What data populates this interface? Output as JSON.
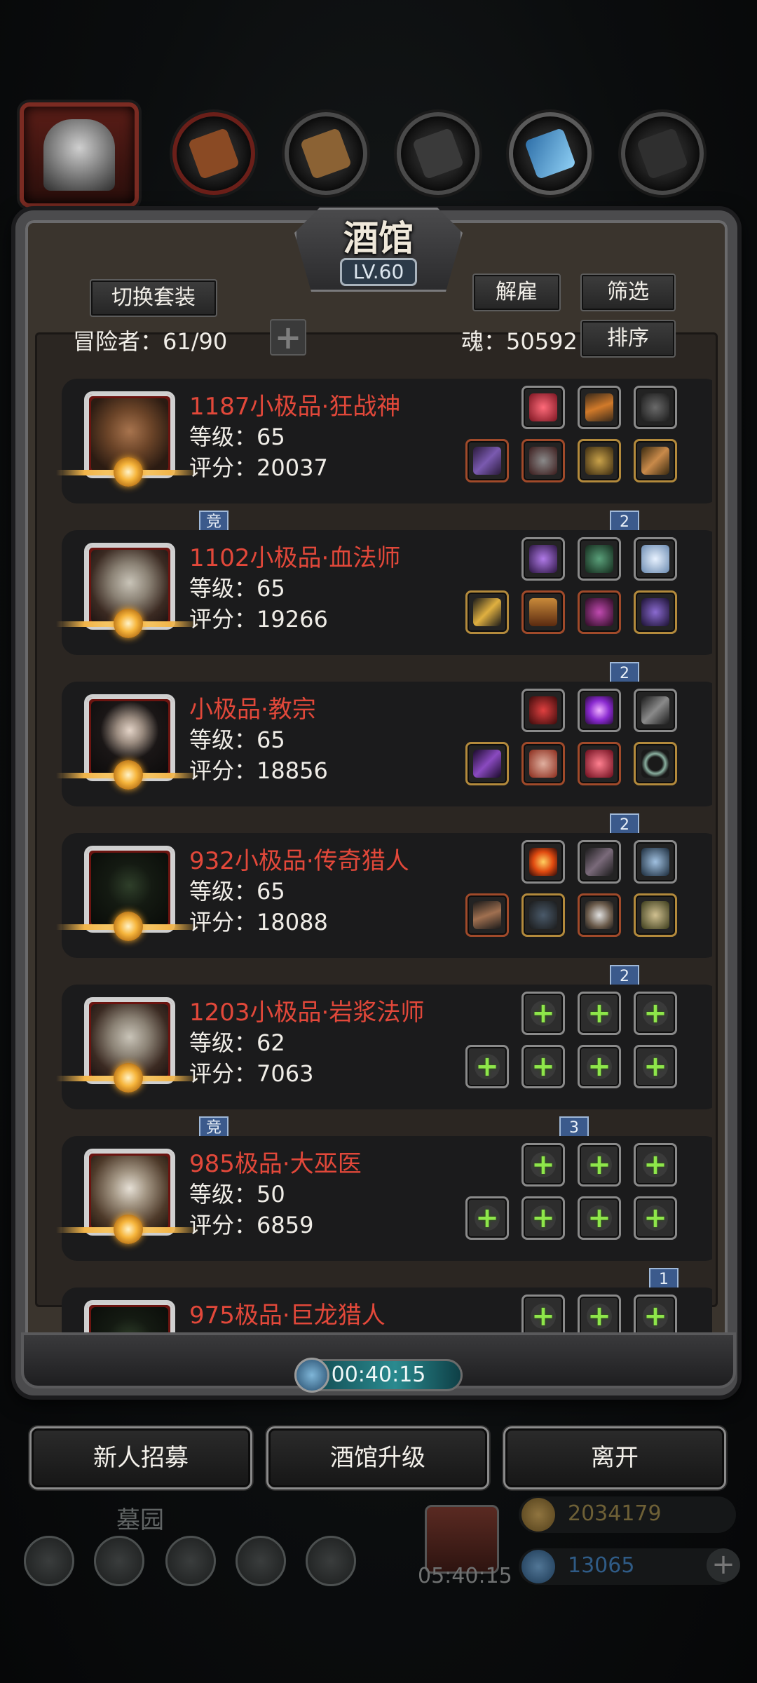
{
  "tavern": {
    "title": "酒馆",
    "level": "LV.60"
  },
  "toolbar": {
    "switch_set_label": "切换套装",
    "dismiss_label": "解雇",
    "filter_label": "筛选",
    "sort_label": "排序"
  },
  "stats": {
    "adventurers_label": "冒险者：61/90",
    "soul_label": "魂：50592",
    "add_symbol": "+"
  },
  "heroes": [
    {
      "name": "1187小极品·狂战神",
      "level_text": "等级：65",
      "score_text": "评分：20037",
      "badge_left": "竞",
      "badge_right": "2"
    },
    {
      "name": "1102小极品·血法师",
      "level_text": "等级：65",
      "score_text": "评分：19266",
      "badge_left": "",
      "badge_right": "2"
    },
    {
      "name": "小极品·教宗",
      "level_text": "等级：65",
      "score_text": "评分：18856",
      "badge_left": "",
      "badge_right": "2"
    },
    {
      "name": "932小极品·传奇猎人",
      "level_text": "等级：65",
      "score_text": "评分：18088",
      "badge_left": "",
      "badge_right": "2"
    },
    {
      "name": "1203小极品·岩浆法师",
      "level_text": "等级：62",
      "score_text": "评分：7063",
      "badge_left": "竞",
      "badge_right": "3"
    },
    {
      "name": "985极品·大巫医",
      "level_text": "等级：50",
      "score_text": "评分：6859",
      "badge_left": "",
      "badge_right": "1"
    },
    {
      "name": "975极品·巨龙猎人",
      "level_text": "",
      "score_text": "",
      "badge_left": "",
      "badge_right": ""
    }
  ],
  "timer": {
    "value": "00:40:15"
  },
  "actions": {
    "recruit_label": "新人招募",
    "upgrade_label": "酒馆升级",
    "leave_label": "离开"
  },
  "background_hud": {
    "area_label": "墓园",
    "gift_timer": "05:40:15",
    "gold_amount": "2034179",
    "diamond_amount": "13065"
  },
  "colors": {
    "hero_name": "#e2483a",
    "equip_plus": "#8ee64a",
    "panel": "#3a342d"
  }
}
